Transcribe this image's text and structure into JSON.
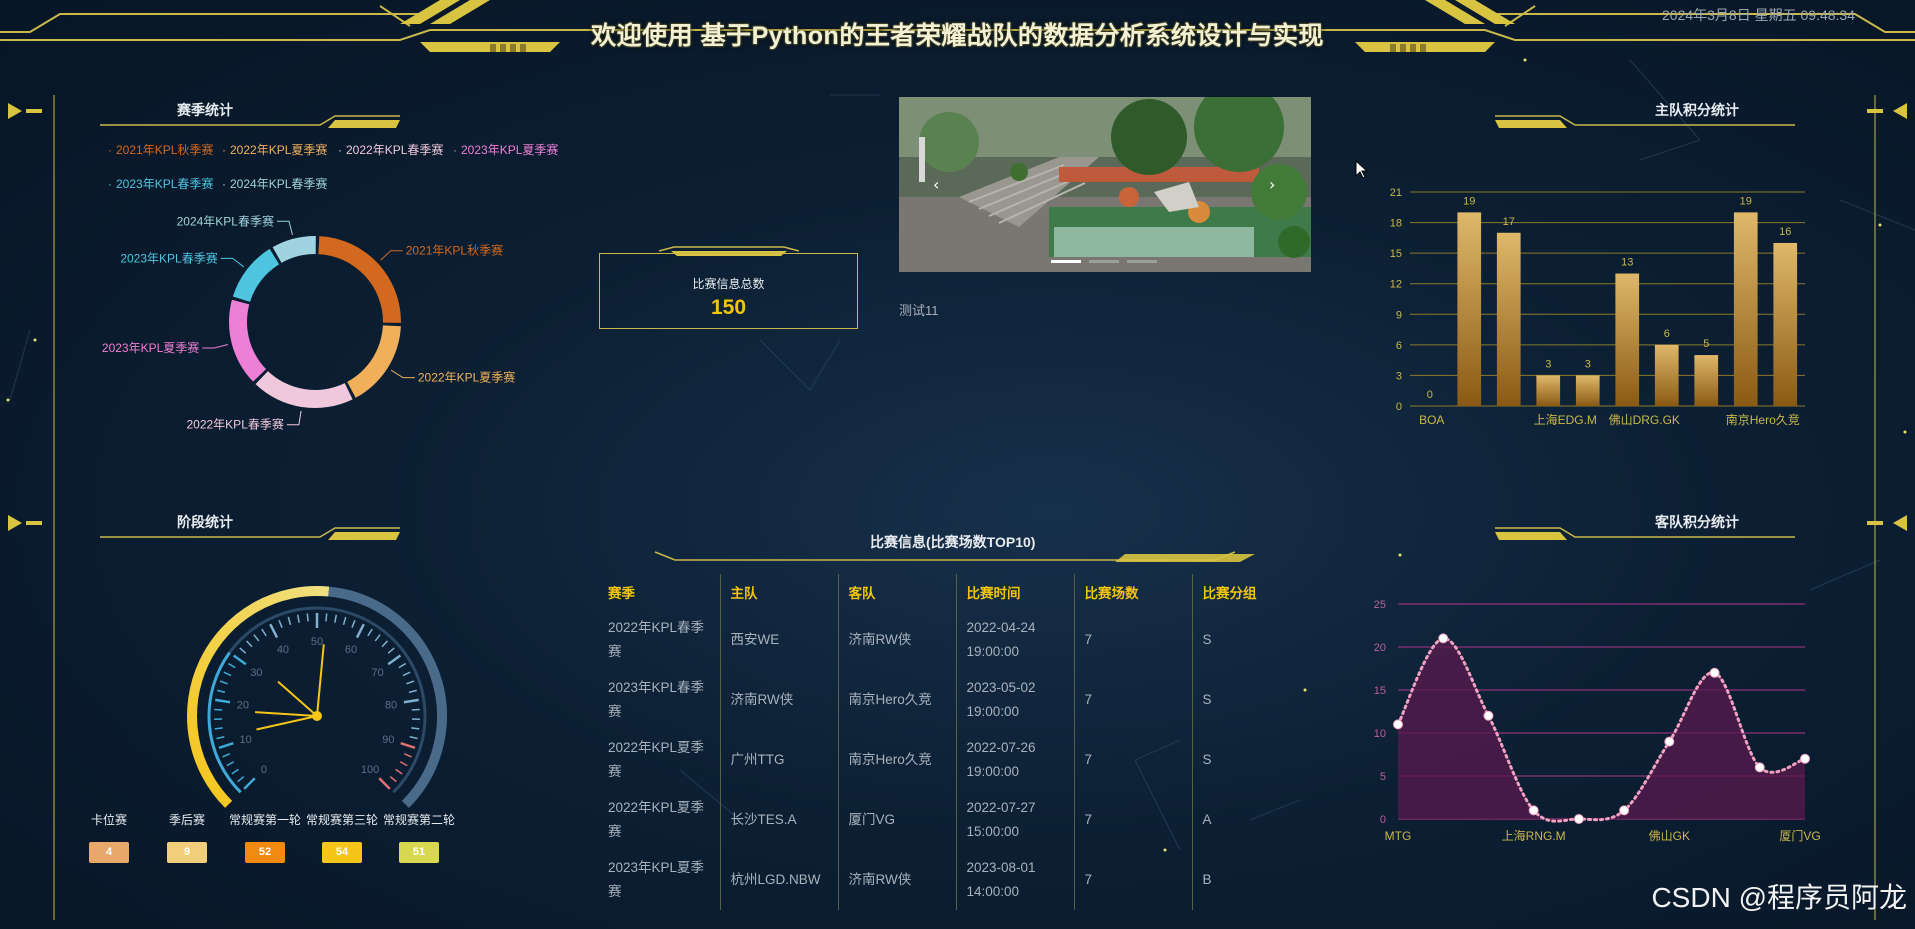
{
  "header": {
    "title": "欢迎使用 基于Python的王者荣耀战队的数据分析系统设计与实现",
    "datetime": "2024年3月8日 星期五 09:48:34"
  },
  "season_panel": {
    "title": "赛季统计",
    "legend": [
      {
        "label": "2021年KPL秋季赛",
        "color": "#d2691e"
      },
      {
        "label": "2022年KPL夏季赛",
        "color": "#f0b05a"
      },
      {
        "label": "2022年KPL春季赛",
        "color": "#f0c8dc"
      },
      {
        "label": "2023年KPL夏季赛",
        "color": "#ee7fd6"
      },
      {
        "label": "2023年KPL春季赛",
        "color": "#4ec5e0"
      },
      {
        "label": "2024年KPL春季赛",
        "color": "#9fd3df"
      }
    ],
    "chart_data": {
      "type": "pie",
      "donut": true,
      "categories": [
        "2021年KPL秋季赛",
        "2022年KPL夏季赛",
        "2022年KPL春季赛",
        "2023年KPL夏季赛",
        "2023年KPL春季赛",
        "2024年KPL春季赛"
      ],
      "values": [
        25,
        17,
        20,
        17,
        12,
        9
      ],
      "colors": [
        "#d2691e",
        "#f0b05a",
        "#f0c8dc",
        "#ee7fd6",
        "#4ec5e0",
        "#9fd3df"
      ]
    }
  },
  "stage_panel": {
    "title": "阶段统计",
    "gauge": {
      "value": 52,
      "min": 0,
      "max": 100,
      "ticks": [
        "0",
        "10",
        "20",
        "30",
        "40",
        "50",
        "60",
        "70",
        "80",
        "90",
        "100"
      ]
    },
    "stages": [
      {
        "name": "卡位赛",
        "value": "4",
        "color": "#e8a86a"
      },
      {
        "name": "季后赛",
        "value": "9",
        "color": "#f1cf7a"
      },
      {
        "name": "常规赛第一轮",
        "value": "52",
        "color": "#f08a10"
      },
      {
        "name": "常规赛第三轮",
        "value": "54",
        "color": "#f5c518"
      },
      {
        "name": "常规赛第二轮",
        "value": "51",
        "color": "#d8d850"
      }
    ]
  },
  "kpi": {
    "label": "比赛信息总数",
    "value": "150"
  },
  "test_label": "测试11",
  "match_table": {
    "title": "比赛信息(比赛场数TOP10)",
    "columns": [
      "赛季",
      "主队",
      "客队",
      "比赛时间",
      "比赛场数",
      "比赛分组"
    ],
    "rows": [
      [
        "2022年KPL春季赛",
        "西安WE",
        "济南RW侠",
        "2022-04-24 19:00:00",
        "7",
        "S"
      ],
      [
        "2023年KPL春季赛",
        "济南RW侠",
        "南京Hero久竞",
        "2023-05-02 19:00:00",
        "7",
        "S"
      ],
      [
        "2022年KPL夏季赛",
        "广州TTG",
        "南京Hero久竞",
        "2022-07-26 19:00:00",
        "7",
        "S"
      ],
      [
        "2022年KPL夏季赛",
        "长沙TES.A",
        "厦门VG",
        "2022-07-27 15:00:00",
        "7",
        "A"
      ],
      [
        "2023年KPL夏季赛",
        "杭州LGD.NBW",
        "济南RW侠",
        "2023-08-01 14:00:00",
        "7",
        "B"
      ]
    ]
  },
  "home_panel": {
    "title": "主队积分统计",
    "chart_data": {
      "type": "bar",
      "values": [
        0,
        19,
        17,
        3,
        3,
        13,
        6,
        5,
        19,
        16
      ],
      "x_tick_labels": [
        "BOA",
        "上海EDG.M",
        "佛山DRG.GK",
        "南京Hero久竞"
      ],
      "ylim": [
        0,
        21
      ],
      "y_ticks": [
        0,
        3,
        6,
        9,
        12,
        15,
        18,
        21
      ],
      "grid": true
    }
  },
  "away_panel": {
    "title": "客队积分统计",
    "chart_data": {
      "type": "area",
      "values": [
        11,
        21,
        12,
        1,
        0,
        1,
        9,
        17,
        6,
        7
      ],
      "x_tick_labels": [
        "MTG",
        "上海RNG.M",
        "佛山GK",
        "厦门VG"
      ],
      "ylim": [
        0,
        25
      ],
      "y_ticks": [
        0,
        5,
        10,
        15,
        20,
        25
      ],
      "grid": true
    }
  },
  "watermark": "CSDN @程序员阿龙"
}
